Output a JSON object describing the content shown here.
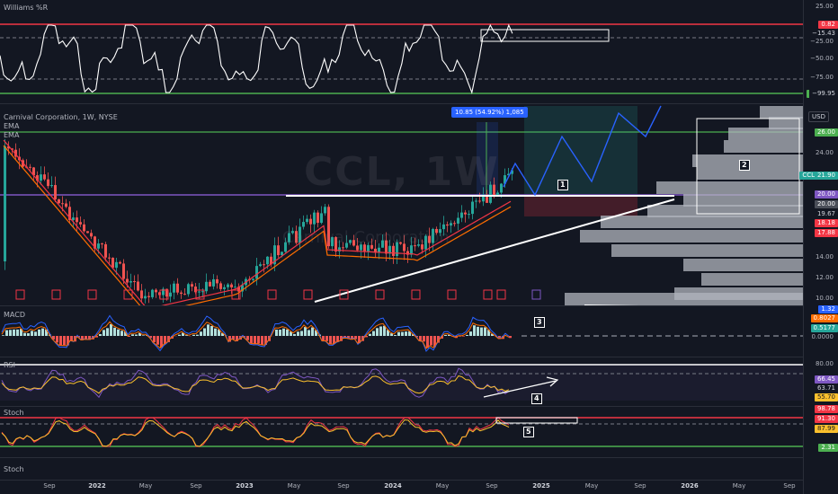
{
  "panes": {
    "willr": {
      "label": "Williams %R"
    },
    "main": {
      "label": "Carnival Corporation, 1W, NYSE",
      "ema1": "EMA",
      "ema2": "EMA",
      "watermark_big": "CCL, 1W",
      "watermark_small": "Carnival Corporation"
    },
    "macd": {
      "label": "MACD"
    },
    "rsi": {
      "label": "RSI"
    },
    "stoch": {
      "label": "Stoch"
    },
    "stoch2": {
      "label": "Stoch"
    }
  },
  "measure_label": "10.85 (54.92%) 1,085",
  "annotations": [
    "1",
    "2",
    "3",
    "4",
    "5"
  ],
  "earnings_marker": "E",
  "right_axis": {
    "currency": "USD",
    "willr_ticks": [
      "25.00",
      "−25.00",
      "−50.00",
      "−75.00"
    ],
    "willr_tags": [
      "0.82",
      "−15.43",
      "−99.95"
    ],
    "price_ticks": [
      "24.00",
      "22.00",
      "16.00",
      "14.00",
      "12.00",
      "10.00"
    ],
    "price_tags": {
      "top": "26.00",
      "ccl_name": "CCL",
      "ccl_price": "21.90",
      "level": "20.00",
      "level2": "20.00",
      "p1": "19.67",
      "p2": "18.18",
      "p3": "17.88"
    },
    "macd_tags": [
      "1.32",
      "0.8027",
      "0.5177",
      "0.0000"
    ],
    "rsi_tags": [
      "80.00",
      "66.45",
      "63.71",
      "55.70"
    ],
    "stoch_tags": [
      "98.78",
      "91.30",
      "87.99",
      "2.31"
    ]
  },
  "time_axis": [
    {
      "label": "Sep",
      "bold": false
    },
    {
      "label": "2022",
      "bold": true
    },
    {
      "label": "May",
      "bold": false
    },
    {
      "label": "Sep",
      "bold": false
    },
    {
      "label": "2023",
      "bold": true
    },
    {
      "label": "May",
      "bold": false
    },
    {
      "label": "Sep",
      "bold": false
    },
    {
      "label": "2024",
      "bold": true
    },
    {
      "label": "May",
      "bold": false
    },
    {
      "label": "Sep",
      "bold": false
    },
    {
      "label": "2025",
      "bold": true
    },
    {
      "label": "May",
      "bold": false
    },
    {
      "label": "Sep",
      "bold": false
    },
    {
      "label": "2026",
      "bold": true
    },
    {
      "label": "May",
      "bold": false
    },
    {
      "label": "Sep",
      "bold": false
    }
  ],
  "colors": {
    "bull": "#26a69a",
    "bear": "#ef5350",
    "ema_red": "#f23645",
    "ema_orange": "#ff6d00",
    "purple": "#7e57c2",
    "green_line": "#4caf50",
    "red_line": "#f23645",
    "blue": "#2962ff"
  }
}
